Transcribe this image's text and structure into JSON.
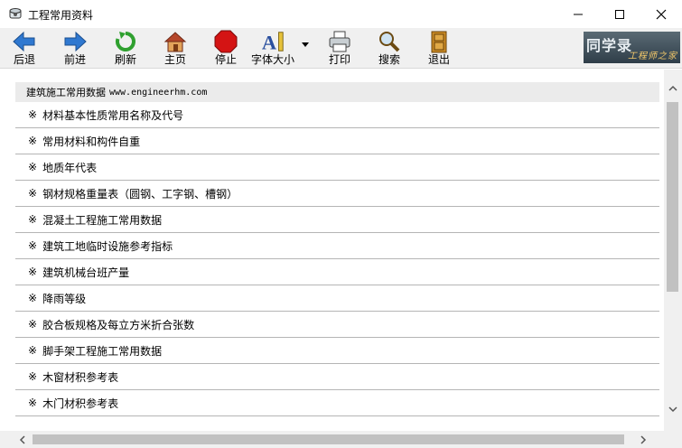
{
  "window": {
    "title": "工程常用资料"
  },
  "toolbar": {
    "buttons": [
      {
        "label": "后退",
        "icon": "back-arrow-icon"
      },
      {
        "label": "前进",
        "icon": "forward-arrow-icon"
      },
      {
        "label": "刷新",
        "icon": "refresh-icon"
      },
      {
        "label": "主页",
        "icon": "home-icon"
      },
      {
        "label": "停止",
        "icon": "stop-icon"
      },
      {
        "label": "字体大小",
        "icon": "font-size-icon"
      },
      {
        "label": "打印",
        "icon": "printer-icon"
      },
      {
        "label": "搜索",
        "icon": "magnifier-icon"
      },
      {
        "label": "退出",
        "icon": "exit-door-icon"
      }
    ]
  },
  "logo": {
    "line1": "同学录",
    "line2": "工程师之家"
  },
  "content": {
    "header_title": "建筑施工常用数据",
    "header_url": "www.engineerhm.com",
    "bullet": "※",
    "items": [
      "材料基本性质常用名称及代号",
      "常用材料和构件自重",
      "地质年代表",
      "钢材规格重量表（圆钢、工字钢、槽钢）",
      "混凝土工程施工常用数据",
      "建筑工地临时设施参考指标",
      "建筑机械台班产量",
      "降雨等级",
      "胶合板规格及每立方米折合张数",
      "脚手架工程施工常用数据",
      "木窗材积参考表",
      "木门材积参考表"
    ]
  },
  "colors": {
    "toolbar_bg": "#f0f0f0",
    "header_row_bg": "#ebebeb",
    "row_separator": "#b5b5b5",
    "logo_bg": "#3a4954",
    "logo_accent": "#f4c96a"
  }
}
